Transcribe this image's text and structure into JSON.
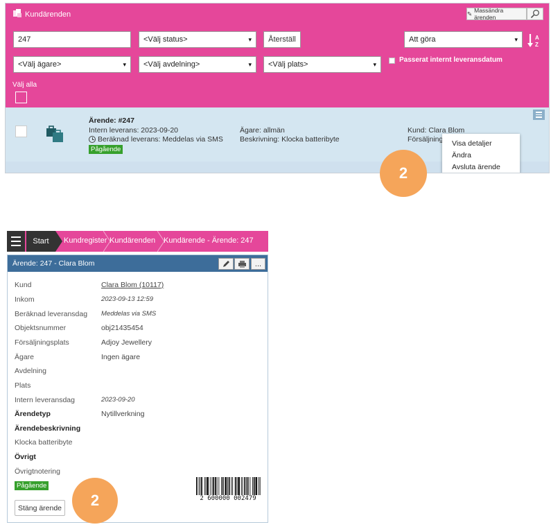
{
  "list_panel": {
    "title": "Kundärenden",
    "mass_edit_label": "Massändra ärenden",
    "search_value": "247",
    "status_select": "<Välj status>",
    "reset_label": "Återställ",
    "todo_select": "Att göra",
    "owner_select": "<Välj ägare>",
    "department_select": "<Välj avdelning>",
    "location_select": "<Välj plats>",
    "overdue_label": "Passerat internt leveransdatum",
    "select_all_label": "Välj alla",
    "row": {
      "case_title": "Ärende: #247",
      "internal_delivery": "Intern leverans: 2023-09-20",
      "estimated_delivery": "Beräknad leverans: Meddelas via SMS",
      "status_badge": "Pågående",
      "owner": "Ägare: allmän",
      "description": "Beskrivning: Klocka batteribyte",
      "customer": "Kund: Clara Blom",
      "sales": "Försäljningsp"
    },
    "context_menu": [
      "Visa detaljer",
      "Ändra",
      "Avsluta ärende"
    ],
    "callout_number": "2"
  },
  "detail_panel": {
    "breadcrumb": [
      "Start",
      "Kundregister",
      "Kundärenden",
      "Kundärende - Ärende: 247"
    ],
    "card_title": "Ärende: 247 - Clara Blom",
    "more_label": "...",
    "fields": [
      {
        "label": "Kund",
        "value": "Clara Blom (10117)"
      },
      {
        "label": "Inkom",
        "value": "2023-09-13 12:59"
      },
      {
        "label": "Beräknad leveransdag",
        "value": "Meddelas via SMS"
      },
      {
        "label": "Objektsnummer",
        "value": "obj21435454"
      },
      {
        "label": "Försäljningsplats",
        "value": "Adjoy Jewellery"
      },
      {
        "label": "Ägare",
        "value": "Ingen ägare"
      },
      {
        "label": "Avdelning",
        "value": ""
      },
      {
        "label": "Plats",
        "value": ""
      },
      {
        "label": "Intern leveransdag",
        "value": "2023-09-20"
      },
      {
        "label": "Ärendetyp",
        "value": "Nytillverkning"
      },
      {
        "label": "Ärendebeskrivning",
        "value": ""
      },
      {
        "label": "Klocka batteribyte",
        "value": ""
      },
      {
        "label": "Övrigt",
        "value": ""
      },
      {
        "label": "Övrigtnotering",
        "value": ""
      }
    ],
    "status_badge": "Pågående",
    "barcode_number": "2 600000 002479",
    "close_label": "Stäng ärende",
    "callout_number": "2"
  }
}
